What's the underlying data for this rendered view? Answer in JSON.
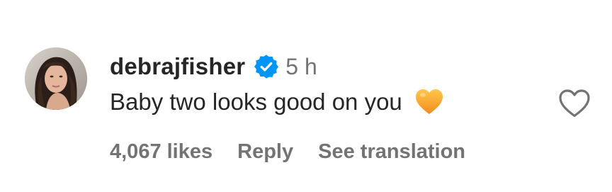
{
  "comment": {
    "username": "debrajfisher",
    "verified": true,
    "timestamp": "5 h",
    "text": "Baby two looks good on you",
    "emoji": "orange-heart",
    "likes_label": "4,067 likes",
    "reply_label": "Reply",
    "translation_label": "See translation"
  },
  "colors": {
    "text_primary": "#262626",
    "text_secondary": "#737373",
    "verified_badge": "#0095F6",
    "heart_outline": "#737373",
    "emoji_heart": "#F7A531"
  },
  "icons": {
    "verified": "verified-badge-icon",
    "like": "heart-outline-icon",
    "emoji": "orange-heart-emoji"
  }
}
